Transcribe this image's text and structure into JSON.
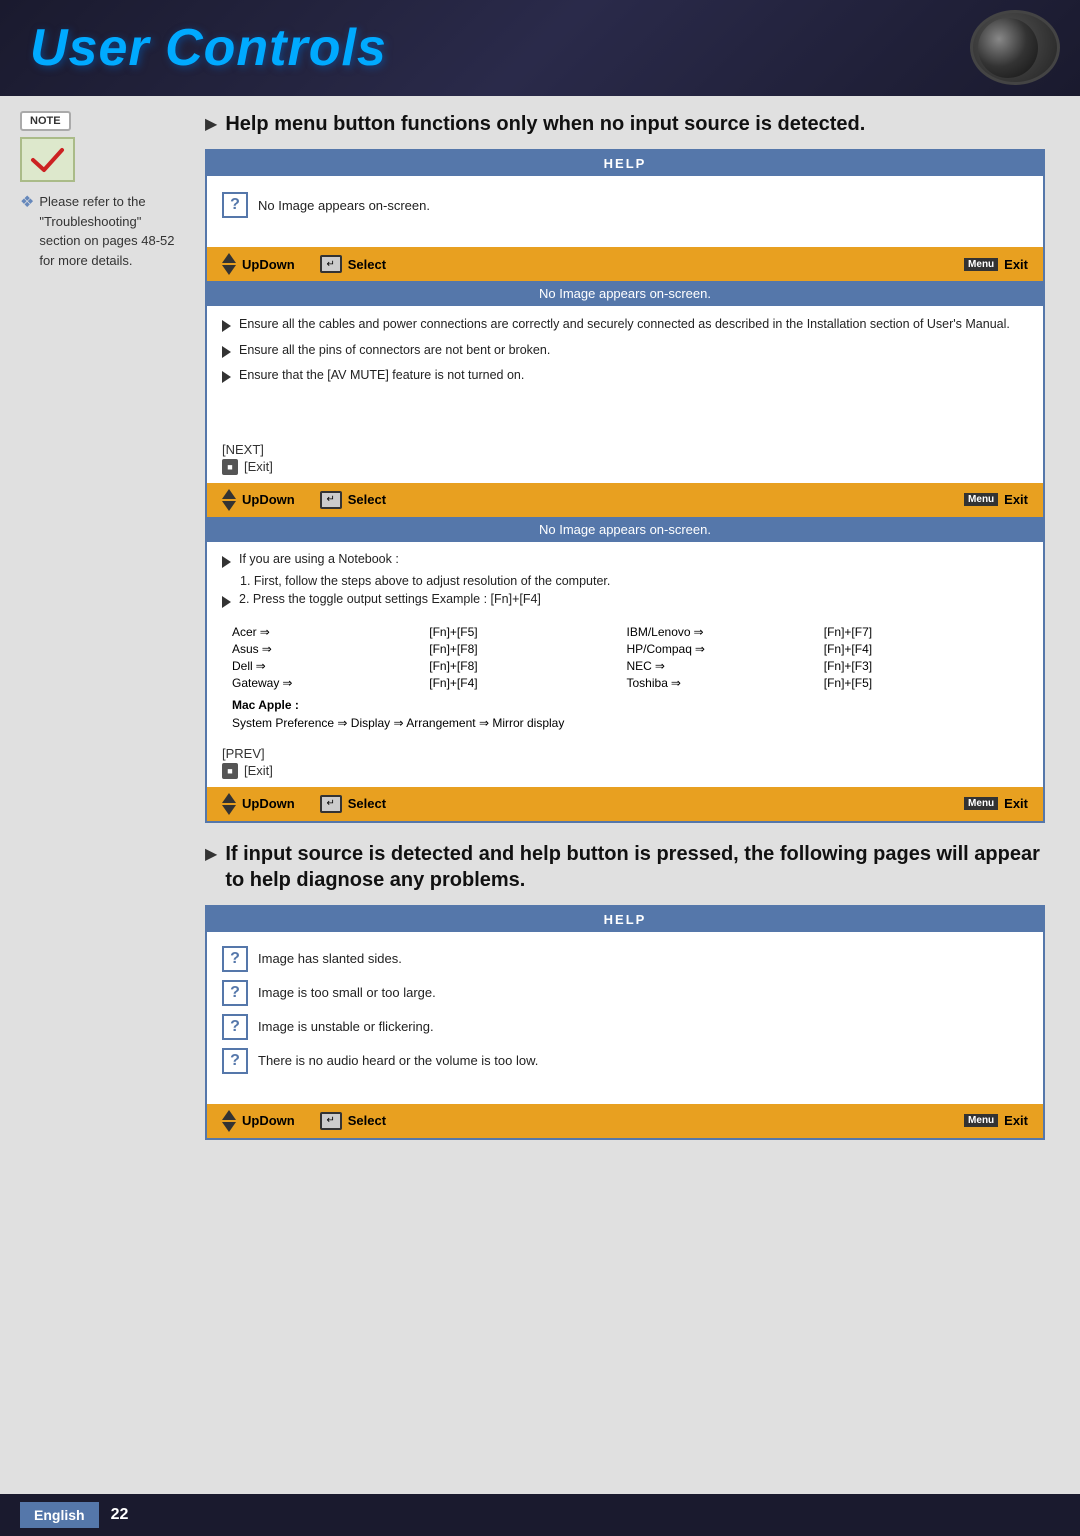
{
  "header": {
    "title": "User Controls"
  },
  "section1": {
    "heading": "Help menu button functions only when no input source is detected."
  },
  "note": {
    "badge": "NOTE",
    "text": "Please refer to the \"Troubleshooting\" section on pages 48-52 for more details."
  },
  "help_panel_1": {
    "title": "HELP",
    "row": "No Image appears on-screen."
  },
  "nav_bar": {
    "updown": "UpDown",
    "select": "Select",
    "exit": "Exit"
  },
  "status_bar_1": "No Image appears on-screen.",
  "content_1": {
    "bullets": [
      "Ensure all the cables and power connections are correctly and securely connected as described in the Installation section of User's Manual.",
      "Ensure all the pins of connectors are not bent or broken.",
      "Ensure that the [AV MUTE] feature is not turned on."
    ]
  },
  "nav_links_1": {
    "next": "[NEXT]",
    "exit": "[Exit]"
  },
  "status_bar_2": "No Image appears on-screen.",
  "content_2": {
    "intro": "If you are using a Notebook :",
    "step1": "1. First, follow the steps above to adjust resolution of the computer.",
    "step2": "2. Press the toggle output settings  Example : [Fn]+[F4]"
  },
  "laptop_table": [
    {
      "brand": "Acer",
      "key": "[Fn]+[F5]"
    },
    {
      "brand": "IBM/Lenovo",
      "key": "[Fn]+[F7]"
    },
    {
      "brand": "Asus",
      "key": "[Fn]+[F8]"
    },
    {
      "brand": "HP/Compaq",
      "key": "[Fn]+[F4]"
    },
    {
      "brand": "Dell",
      "key": "[Fn]+[F8]"
    },
    {
      "brand": "NEC",
      "key": "[Fn]+[F3]"
    },
    {
      "brand": "Gateway",
      "key": "[Fn]+[F4]"
    },
    {
      "brand": "Toshiba",
      "key": "[Fn]+[F5]"
    }
  ],
  "mac_section": {
    "label": "Mac Apple :",
    "pref": "System Preference",
    "display": "Display",
    "arrangement": "Arrangement",
    "mirror": "Mirror display"
  },
  "nav_links_2": {
    "prev": "[PREV]",
    "exit": "[Exit]"
  },
  "section2": {
    "heading": "If input source is detected and help button is pressed, the following pages will appear to help diagnose any problems."
  },
  "help_panel_2": {
    "title": "HELP",
    "rows": [
      "Image has slanted sides.",
      "Image is too small or too large.",
      "Image is unstable or flickering.",
      "There is no audio heard or the volume is too low."
    ]
  },
  "footer": {
    "language": "English",
    "page": "22"
  }
}
